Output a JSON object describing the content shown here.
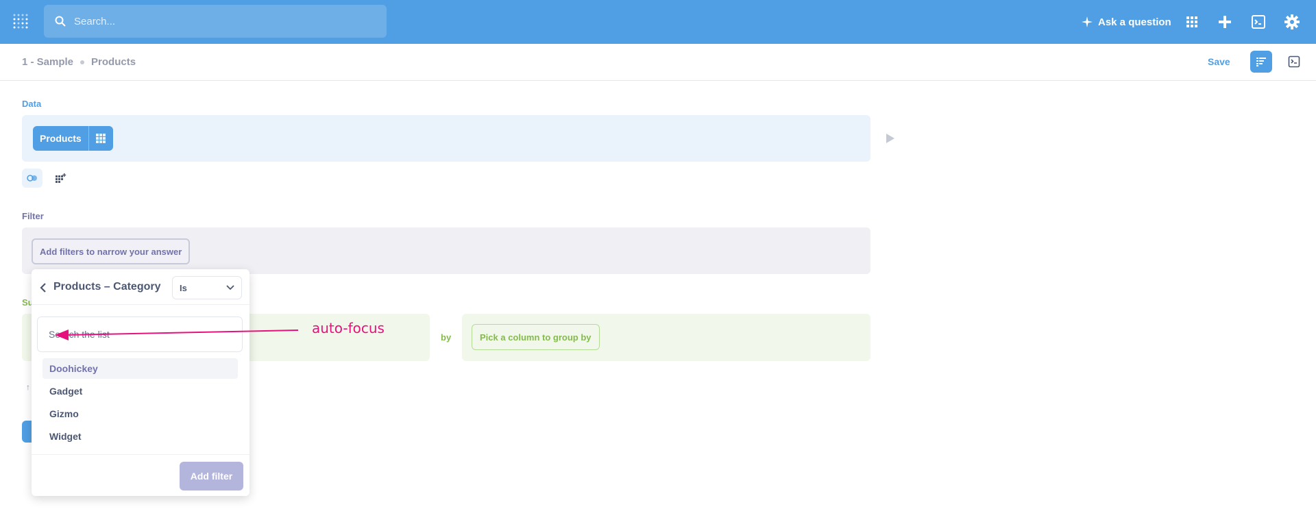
{
  "nav": {
    "search_placeholder": "Search...",
    "ask_label": "Ask a question"
  },
  "header": {
    "breadcrumb_db": "1 - Sample",
    "breadcrumb_table": "Products",
    "save_label": "Save"
  },
  "data_section": {
    "label": "Data",
    "table_name": "Products"
  },
  "filter_section": {
    "label": "Filter",
    "add_filters_label": "Add filters to narrow your answer"
  },
  "summarize_section": {
    "label_partial": "Su",
    "by_label": "by",
    "group_by_label": "Pick a column to group by"
  },
  "popover": {
    "title": "Products – Category",
    "operator": "Is",
    "search_placeholder": "Search the list",
    "options": [
      "Doohickey",
      "Gadget",
      "Gizmo",
      "Widget"
    ],
    "add_filter_label": "Add filter"
  },
  "annotation": {
    "text": "auto-focus"
  },
  "colors": {
    "brand": "#509ee3",
    "filter": "#7172ad",
    "summarize": "#84bb4c",
    "annotation": "#e5127d"
  }
}
